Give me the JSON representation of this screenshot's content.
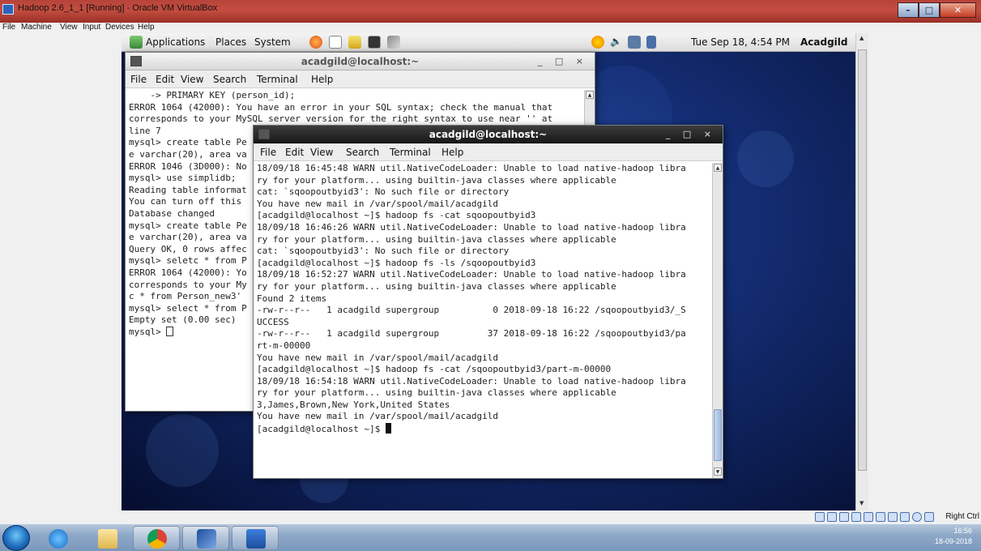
{
  "host_window": {
    "title": "Hadoop 2.6_1_1 [Running] - Oracle VM VirtualBox",
    "menu": [
      "File",
      "Machine",
      "View",
      "Input",
      "Devices",
      "Help"
    ]
  },
  "gnome_panel": {
    "menus": [
      "Applications",
      "Places",
      "System"
    ],
    "clock": "Tue Sep 18,  4:54 PM",
    "user": "Acadgild"
  },
  "terminal_back": {
    "title": "acadgild@localhost:~",
    "menu": [
      "File",
      "Edit",
      "View",
      "Search",
      "Terminal",
      "Help"
    ],
    "lines": [
      "    -> PRIMARY KEY (person_id);",
      "ERROR 1064 (42000): You have an error in your SQL syntax; check the manual that",
      "corresponds to your MySQL server version for the right syntax to use near '' at",
      "line 7",
      "mysql> create table Pe",
      "e varchar(20), area va",
      "ERROR 1046 (3D000): No",
      "mysql> use simplidb;",
      "Reading table informat",
      "You can turn off this",
      "",
      "Database changed",
      "mysql> create table Pe",
      "e varchar(20), area va",
      "Query OK, 0 rows affec",
      "",
      "mysql> seletc * from P",
      "ERROR 1064 (42000): Yo",
      "corresponds to your My",
      "c * from Person_new3' ",
      "mysql> select * from P",
      "Empty set (0.00 sec)",
      "",
      "mysql> "
    ]
  },
  "terminal_front": {
    "title": "acadgild@localhost:~",
    "menu": [
      "File",
      "Edit",
      "View",
      "Search",
      "Terminal",
      "Help"
    ],
    "lines": [
      "18/09/18 16:45:48 WARN util.NativeCodeLoader: Unable to load native-hadoop libra",
      "ry for your platform... using builtin-java classes where applicable",
      "cat: `sqoopoutbyid3': No such file or directory",
      "You have new mail in /var/spool/mail/acadgild",
      "[acadgild@localhost ~]$ hadoop fs -cat sqoopoutbyid3",
      "18/09/18 16:46:26 WARN util.NativeCodeLoader: Unable to load native-hadoop libra",
      "ry for your platform... using builtin-java classes where applicable",
      "cat: `sqoopoutbyid3': No such file or directory",
      "[acadgild@localhost ~]$ hadoop fs -ls /sqoopoutbyid3",
      "18/09/18 16:52:27 WARN util.NativeCodeLoader: Unable to load native-hadoop libra",
      "ry for your platform... using builtin-java classes where applicable",
      "Found 2 items",
      "-rw-r--r--   1 acadgild supergroup          0 2018-09-18 16:22 /sqoopoutbyid3/_S",
      "UCCESS",
      "-rw-r--r--   1 acadgild supergroup         37 2018-09-18 16:22 /sqoopoutbyid3/pa",
      "rt-m-00000",
      "You have new mail in /var/spool/mail/acadgild",
      "[acadgild@localhost ~]$ hadoop fs -cat /sqoopoutbyid3/part-m-00000",
      "18/09/18 16:54:18 WARN util.NativeCodeLoader: Unable to load native-hadoop libra",
      "ry for your platform... using builtin-java classes where applicable",
      "3,James,Brown,New York,United States",
      "You have new mail in /var/spool/mail/acadgild",
      "[acadgild@localhost ~]$ "
    ]
  },
  "vbox_status": {
    "host_key": "Right Ctrl"
  },
  "taskbar": {
    "time": "16:56",
    "date": "18-09-2018"
  }
}
